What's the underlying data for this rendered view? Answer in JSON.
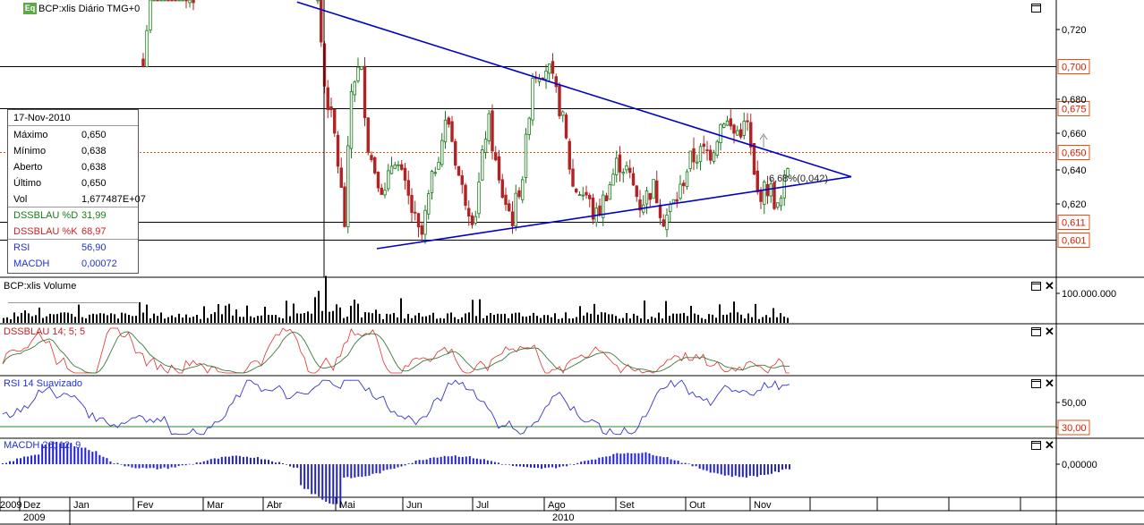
{
  "header": {
    "badge": "Eq",
    "title": "BCP:xlis Diário TMG+0"
  },
  "hud": {
    "date": "17-Nov-2010",
    "rows": [
      {
        "label": "Máximo",
        "value": "0,650",
        "color": "#000000"
      },
      {
        "label": "Mínimo",
        "value": "0,638",
        "color": "#000000"
      },
      {
        "label": "Aberto",
        "value": "0,638",
        "color": "#000000"
      },
      {
        "label": "Último",
        "value": "0,650",
        "color": "#000000"
      },
      {
        "label": "Vol",
        "value": "1,677487E+07",
        "color": "#000000"
      },
      {
        "label": "DSSBLAU %D",
        "value": "31,99",
        "color": "#1a7a1a"
      },
      {
        "label": "DSSBLAU %K",
        "value": "68,97",
        "color": "#cc2222"
      },
      {
        "label": "RSI",
        "value": "56,90",
        "color": "#2233cc"
      },
      {
        "label": "MACDH",
        "value": "0,00072",
        "color": "#2233cc"
      }
    ]
  },
  "panes": {
    "volume_title": "BCP:xlis Volume",
    "dss_title": "DSSBLAU 14; 5; 5",
    "rsi_title": "RSI 14 Suavizado",
    "macd_title": "MACDH 26; 12; 9"
  },
  "annotation": "6,68%(0,042)",
  "colors": {
    "bull": "#1a7a1a",
    "bear": "#b22222",
    "trend": "#0000cc",
    "hline": "#000000",
    "last": "#e05010",
    "dssK": "#e03030",
    "dssD": "#3a7a3a",
    "rsi": "#3333cc",
    "macd": "#2222cc",
    "rsi30": "#2a8a2a"
  },
  "chart_data": [
    {
      "type": "candlestick",
      "ylim": [
        0.585,
        0.735
      ],
      "y_ticks": [
        "0,720",
        "0,680",
        "0,660",
        "0,640",
        "0,620"
      ],
      "levels": [
        {
          "value": 0.7,
          "label": "0,700"
        },
        {
          "value": 0.675,
          "label": "0,675"
        },
        {
          "value": 0.65,
          "label": "0,650",
          "style": "last"
        },
        {
          "value": 0.611,
          "label": "0,611"
        },
        {
          "value": 0.601,
          "label": "0,601"
        }
      ],
      "trendlines": [
        {
          "from": [
            "2010-04-15",
            0.735
          ],
          "to": [
            "2010-12-20",
            0.636
          ]
        },
        {
          "from": [
            "2010-05-20",
            0.596
          ],
          "to": [
            "2010-12-20",
            0.636
          ]
        }
      ],
      "last": {
        "date": "2010-11-17",
        "open": 0.638,
        "high": 0.65,
        "low": 0.638,
        "close": 0.65
      }
    },
    {
      "type": "bar",
      "title": "BCP:xlis Volume",
      "y_ticks": [
        "100.000.000"
      ]
    },
    {
      "type": "line",
      "title": "DSSBLAU 14; 5; 5",
      "series": [
        {
          "name": "DSSBLAU %K"
        },
        {
          "name": "DSSBLAU %D"
        }
      ]
    },
    {
      "type": "line",
      "title": "RSI 14 Suavizado",
      "y_ticks": [
        "50,00",
        "30,00"
      ],
      "series": [
        {
          "name": "RSI"
        }
      ]
    },
    {
      "type": "bar",
      "title": "MACDH 26; 12; 9",
      "y_ticks": [
        "0,00000"
      ],
      "series": [
        {
          "name": "MACDH"
        }
      ]
    }
  ],
  "x_axis": {
    "months": [
      "2009",
      "Dez",
      "Jan",
      "Fev",
      "Mar",
      "Abr",
      "Mai",
      "Jun",
      "Jul",
      "Ago",
      "Set",
      "Out",
      "Nov"
    ],
    "years": [
      "2009",
      "2010"
    ]
  }
}
